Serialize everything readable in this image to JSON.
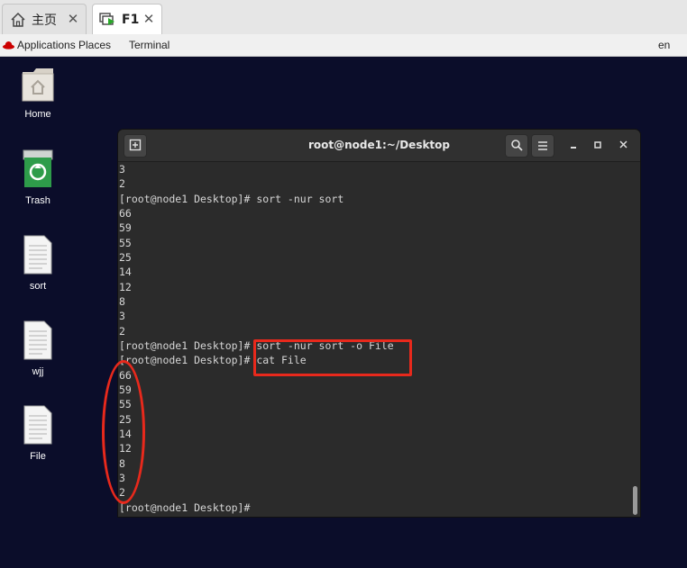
{
  "tabs": [
    {
      "label": "主页",
      "icon": "home-icon"
    },
    {
      "label": "F1",
      "icon": "vm-console-icon"
    }
  ],
  "topbar": {
    "applications": "Applications",
    "places": "Places",
    "terminal": "Terminal",
    "lang": "en"
  },
  "desktop": {
    "icons": [
      {
        "label": "Home",
        "icon": "home-folder-icon"
      },
      {
        "label": "Trash",
        "icon": "trash-icon"
      },
      {
        "label": "sort",
        "icon": "text-file-icon"
      },
      {
        "label": "wjj",
        "icon": "text-file-icon"
      },
      {
        "label": "File",
        "icon": "text-file-icon"
      }
    ]
  },
  "terminal": {
    "title": "root@node1:~/Desktop",
    "lines": [
      "3",
      "2",
      "[root@node1 Desktop]# sort -nur sort",
      "66",
      "59",
      "55",
      "25",
      "14",
      "12",
      "8",
      "3",
      "2",
      "[root@node1 Desktop]# sort -nur sort -o File",
      "[root@node1 Desktop]# cat File",
      "66",
      "59",
      "55",
      "25",
      "14",
      "12",
      "8",
      "3",
      "2",
      "[root@node1 Desktop]#"
    ]
  },
  "colors": {
    "highlight": "#e8291c",
    "desktop_bg": "#0b0d2a",
    "terminal_bg": "#2b2b2b"
  }
}
